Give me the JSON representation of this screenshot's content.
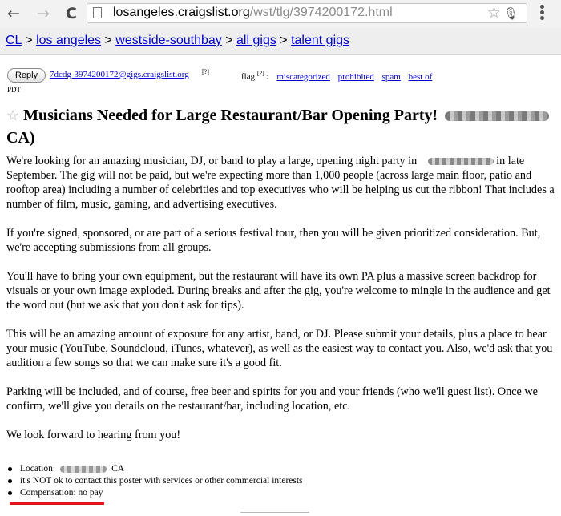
{
  "browser": {
    "back_icon": "←",
    "forward_icon": "→",
    "reload_icon": "C",
    "url_host": "losangeles.craigslist.org",
    "url_path": "/wst/tlg/3974200172.html",
    "bookmark_icon": "☆",
    "mic_icon": "🎙"
  },
  "breadcrumb": {
    "items": [
      "CL",
      "los angeles",
      "westside-southbay",
      "all gigs",
      "talent gigs"
    ],
    "separator": " > "
  },
  "reply_bar": {
    "reply_label": "Reply",
    "email": "7dcdg-3974200172@gigs.craigslist.org",
    "email_footnote": "[?]",
    "flag_label": "flag",
    "flag_footnote": "[?]",
    "flag_colon": " :",
    "flag_links": [
      "miscategorized",
      "prohibited",
      "spam",
      "best of"
    ]
  },
  "timezone": "PDT",
  "posting": {
    "title": "Musicians Needed for Large Restaurant/Bar Opening Party!",
    "title_suffix": "CA)",
    "favorite_icon": "☆",
    "p1_before": "We're looking for an amazing musician, DJ, or band to play a large, opening night party in",
    "p1_after": "in late September. The gig will not be paid, but we're expecting more than 1,000 people (across large main floor, patio and rooftop area) including a number of celebrities and top executives who will be helping us cut the ribbon! That includes a number of film, music, gaming, and advertising executives.",
    "p2": "If you're signed, sponsored, or are part of a serious festival tour, then you will be given prioritized consideration. But, we're accepting submissions from all groups.",
    "p3": "You'll have to bring your own equipment, but the restaurant will have its own PA plus a massive screen backdrop for visuals or your own image exploded. During breaks and after the gig, you're welcome to mingle in the audience and get the word out (but we ask that you don't ask for tips).",
    "p4": "This will be an amazing amount of exposure for any artist, band, or DJ. Please submit your details, plus a place to hear your music (YouTube, Soundcloud, iTunes, whatever), as well as the easiest way to contact you. Also, we'd ask that you audition a few songs so that we can make sure it's a good fit.",
    "p5": "Parking will be included, and of course, free beer and spirits for you and your friends (who we'll guest list). Once we confirm, we'll give you details on the restaurant/bar, including location, etc.",
    "p6": "We look forward to hearing from you!"
  },
  "attributes": {
    "location_label": "Location:",
    "location_state": "CA",
    "contact_note": "it's NOT ok to contact this poster with services or other commercial interests",
    "compensation": "Compensation: no pay"
  },
  "colors": {
    "link": "#0000cc",
    "highlight_underline": "#e2141b"
  }
}
